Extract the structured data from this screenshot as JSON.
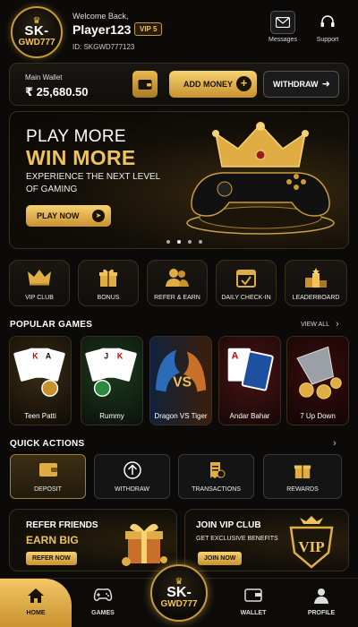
{
  "header": {
    "logo_line1": "SK-",
    "logo_line2": "GWD777",
    "welcome": "Welcome Back,",
    "username": "Player123",
    "vip_badge": "VIP 5",
    "user_id": "ID: SKGWD777123",
    "messages_label": "Messages",
    "support_label": "Support"
  },
  "wallet": {
    "label": "Main Wallet",
    "amount": "₹ 25,680.50",
    "add_money": "ADD MONEY",
    "withdraw": "WITHDRAW"
  },
  "banner": {
    "line1": "PLAY MORE",
    "line2": "WIN MORE",
    "subtitle": "EXPERIENCE THE NEXT LEVEL OF GAMING",
    "cta": "PLAY NOW"
  },
  "quick_tiles": [
    {
      "label": "VIP CLUB",
      "icon": "crown-icon"
    },
    {
      "label": "BONUS",
      "icon": "gift-icon"
    },
    {
      "label": "REFER & EARN",
      "icon": "users-icon"
    },
    {
      "label": "DAILY CHECK-IN",
      "icon": "calendar-check-icon"
    },
    {
      "label": "LEADERBOARD",
      "icon": "podium-icon"
    }
  ],
  "popular_games": {
    "title": "POPULAR GAMES",
    "view_all": "VIEW ALL",
    "games": [
      {
        "label": "Teen Patti"
      },
      {
        "label": "Rummy"
      },
      {
        "label": "Dragon VS Tiger"
      },
      {
        "label": "Andar Bahar"
      },
      {
        "label": "7 Up Down"
      }
    ]
  },
  "quick_actions": {
    "title": "QUICK ACTIONS",
    "items": [
      {
        "label": "DEPOSIT",
        "icon": "wallet-icon"
      },
      {
        "label": "WITHDRAW",
        "icon": "arrow-up-circle-icon"
      },
      {
        "label": "TRANSACTIONS",
        "icon": "receipt-icon"
      },
      {
        "label": "REWARDS",
        "icon": "gift-icon"
      }
    ]
  },
  "promos": {
    "refer": {
      "line1": "REFER FRIENDS",
      "line2": "EARN BIG",
      "button": "REFER NOW"
    },
    "vip": {
      "line1": "JOIN VIP CLUB",
      "line2": "GET EXCLUSIVE BENEFITS",
      "button": "JOIN NOW",
      "shield_text": "VIP"
    }
  },
  "bottom_nav": {
    "home": "HOME",
    "games": "GAMES",
    "wallet": "WALLET",
    "profile": "PROFILE",
    "center_line1": "SK-",
    "center_line2": "GWD777"
  },
  "colors": {
    "accent": "#f0c35a",
    "background": "#0b0a08",
    "card_border": "#3a2f1c"
  }
}
